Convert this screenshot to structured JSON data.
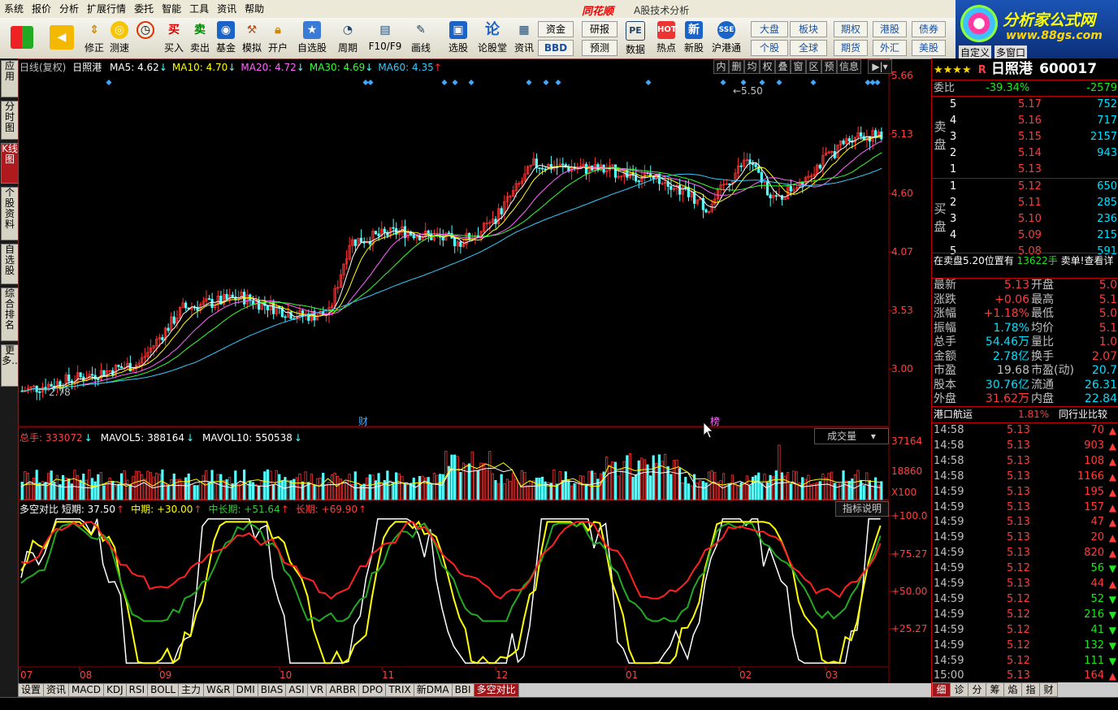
{
  "menu": [
    "系统",
    "报价",
    "分析",
    "扩展行情",
    "委托",
    "智能",
    "工具",
    "资讯",
    "帮助"
  ],
  "brand": "同花顺",
  "app_title": "A股技术分析",
  "logo": {
    "line1": "分析家公式网",
    "line2": "www.88gs.com"
  },
  "toolbar": {
    "buttons": [
      "修正",
      "测速",
      "买入",
      "卖出",
      "基金",
      "模拟",
      "开户",
      "自选股",
      "周期",
      "F10/F9",
      "画线",
      "选股",
      "论股堂",
      "资讯",
      "数据",
      "热点",
      "新股",
      "沪港通"
    ],
    "small": [
      "资金",
      "研报",
      "BBD",
      "预测",
      "大盘",
      "板块",
      "期权",
      "港股",
      "债券",
      "个股",
      "全球",
      "期货",
      "外汇",
      "美股",
      "自定义",
      "多窗口"
    ]
  },
  "left_tabs": [
    "应用",
    "分时图",
    "K线图",
    "个股资料",
    "自选股",
    "综合排名",
    "更多.."
  ],
  "kline_header": {
    "label": "日线(复权)",
    "stock": "日照港",
    "ma": [
      {
        "text": "MA5: 4.62",
        "color": "#ffffff",
        "arrow": "↓"
      },
      {
        "text": "MA10: 4.70",
        "color": "#ffff00",
        "arrow": "↓"
      },
      {
        "text": "MA20: 4.72",
        "color": "#ff66ff",
        "arrow": "↓"
      },
      {
        "text": "MA30: 4.69",
        "color": "#33ff33",
        "arrow": "↓"
      },
      {
        "text": "MA60: 4.35",
        "color": "#33ccff",
        "arrow": "↑"
      }
    ],
    "mini_buttons": [
      "内",
      "删",
      "均",
      "权",
      "叠",
      "窗",
      "区",
      "预",
      "信息"
    ]
  },
  "price_axis": [
    "5.66",
    "5.13",
    "4.60",
    "4.07",
    "3.53",
    "3.00"
  ],
  "annotations": {
    "high": "5.50",
    "low": "2.78",
    "cai": "财",
    "bang": "榜"
  },
  "volume_header": {
    "items": [
      {
        "text": "总手: 333072",
        "color": "#ff4040",
        "arrow": "↓"
      },
      {
        "text": "MAVOL5: 388164",
        "color": "#ffffff",
        "arrow": "↓"
      },
      {
        "text": "MAVOL10: 550538",
        "color": "#ffffff",
        "arrow": "↓"
      }
    ],
    "dropdown": "成交量",
    "axis": [
      "37164",
      "18860",
      "X100"
    ]
  },
  "indicator_header": {
    "items": [
      {
        "text": "多空对比 短期: 37.50",
        "color": "#ffffff",
        "arrow": "↑"
      },
      {
        "text": "中期: +30.00",
        "color": "#ffff00",
        "arrow": "↑"
      },
      {
        "text": "中长期: +51.64",
        "color": "#33cc33",
        "arrow": "↑"
      },
      {
        "text": "长期: +69.90",
        "color": "#ff4040",
        "arrow": "↑"
      }
    ],
    "button": "指标说明",
    "axis": [
      "+100.0",
      "+75.27",
      "+50.00",
      "+25.27"
    ]
  },
  "x_axis": [
    "07",
    "08",
    "09",
    "10",
    "11",
    "12",
    "01",
    "02",
    "03"
  ],
  "bottom_tabs": [
    "设置",
    "资讯",
    "MACD",
    "KDJ",
    "RSI",
    "BOLL",
    "主力",
    "W&R",
    "DMI",
    "BIAS",
    "ASI",
    "VR",
    "ARBR",
    "DPO",
    "TRIX",
    "新DMA",
    "BBI",
    "多空对比"
  ],
  "quote": {
    "stars": "★★★★",
    "r": "R",
    "name": "日照港",
    "code": "600017",
    "weibi_label": "委比",
    "weibi": "-39.34%",
    "weicha": "-2579",
    "sell_label": "卖盘",
    "buy_label": "买盘",
    "sell": [
      {
        "lvl": "5",
        "price": "5.17",
        "vol": "752"
      },
      {
        "lvl": "4",
        "price": "5.16",
        "vol": "717"
      },
      {
        "lvl": "3",
        "price": "5.15",
        "vol": "2157"
      },
      {
        "lvl": "2",
        "price": "5.14",
        "vol": "943"
      },
      {
        "lvl": "1",
        "price": "5.13",
        "vol": ""
      }
    ],
    "buy": [
      {
        "lvl": "1",
        "price": "5.12",
        "vol": "650"
      },
      {
        "lvl": "2",
        "price": "5.11",
        "vol": "285"
      },
      {
        "lvl": "3",
        "price": "5.10",
        "vol": "236"
      },
      {
        "lvl": "4",
        "price": "5.09",
        "vol": "215"
      },
      {
        "lvl": "5",
        "price": "5.08",
        "vol": "591"
      }
    ],
    "notice": "在卖盘5.20位置有",
    "notice_vol": "13622手",
    "notice_tail": "卖单!查看详",
    "stats": [
      {
        "l1": "最新",
        "v1": "5.13",
        "c1": "red",
        "l2": "开盘",
        "v2": "5.0"
      },
      {
        "l1": "涨跌",
        "v1": "+0.06",
        "c1": "red",
        "l2": "最高",
        "v2": "5.1"
      },
      {
        "l1": "涨幅",
        "v1": "+1.18%",
        "c1": "red",
        "l2": "最低",
        "v2": "5.0"
      },
      {
        "l1": "振幅",
        "v1": "1.78%",
        "c1": "cyan",
        "l2": "均价",
        "v2": "5.1"
      },
      {
        "l1": "总手",
        "v1": "54.46万",
        "c1": "cyan",
        "l2": "量比",
        "v2": "1.0"
      },
      {
        "l1": "金额",
        "v1": "2.78亿",
        "c1": "cyan",
        "l2": "换手",
        "v2": "2.07"
      },
      {
        "l1": "市盈",
        "v1": "19.68",
        "c1": "grey",
        "l2": "市盈(动)",
        "v2": "20.7"
      },
      {
        "l1": "股本",
        "v1": "30.76亿",
        "c1": "cyan",
        "l2": "流通",
        "v2": "26.31"
      },
      {
        "l1": "外盘",
        "v1": "31.62万",
        "c1": "red",
        "l2": "内盘",
        "v2": "22.84"
      }
    ],
    "sector": "港口航运",
    "sector_pct": "1.81%",
    "sector_more": "同行业比较",
    "ticks": [
      {
        "t": "14:58",
        "p": "5.13",
        "v": "70",
        "d": "up"
      },
      {
        "t": "14:58",
        "p": "5.13",
        "v": "903",
        "d": "up"
      },
      {
        "t": "14:58",
        "p": "5.13",
        "v": "108",
        "d": "up"
      },
      {
        "t": "14:58",
        "p": "5.13",
        "v": "1166",
        "d": "up"
      },
      {
        "t": "14:59",
        "p": "5.13",
        "v": "195",
        "d": "up"
      },
      {
        "t": "14:59",
        "p": "5.13",
        "v": "157",
        "d": "up"
      },
      {
        "t": "14:59",
        "p": "5.13",
        "v": "47",
        "d": "up"
      },
      {
        "t": "14:59",
        "p": "5.13",
        "v": "20",
        "d": "up"
      },
      {
        "t": "14:59",
        "p": "5.13",
        "v": "820",
        "d": "up"
      },
      {
        "t": "14:59",
        "p": "5.12",
        "v": "56",
        "d": "down"
      },
      {
        "t": "14:59",
        "p": "5.13",
        "v": "44",
        "d": "up"
      },
      {
        "t": "14:59",
        "p": "5.12",
        "v": "52",
        "d": "down"
      },
      {
        "t": "14:59",
        "p": "5.12",
        "v": "216",
        "d": "down"
      },
      {
        "t": "14:59",
        "p": "5.12",
        "v": "41",
        "d": "down"
      },
      {
        "t": "14:59",
        "p": "5.12",
        "v": "132",
        "d": "down"
      },
      {
        "t": "14:59",
        "p": "5.12",
        "v": "111",
        "d": "down"
      },
      {
        "t": "15:00",
        "p": "5.13",
        "v": "164",
        "d": "up"
      }
    ],
    "tabs": [
      "细",
      "诊",
      "分",
      "筹",
      "焰",
      "指",
      "财"
    ]
  },
  "colors": {
    "up": "#ff3232",
    "down": "#54ffff",
    "bg": "#000000",
    "grid": "#8b0000"
  }
}
